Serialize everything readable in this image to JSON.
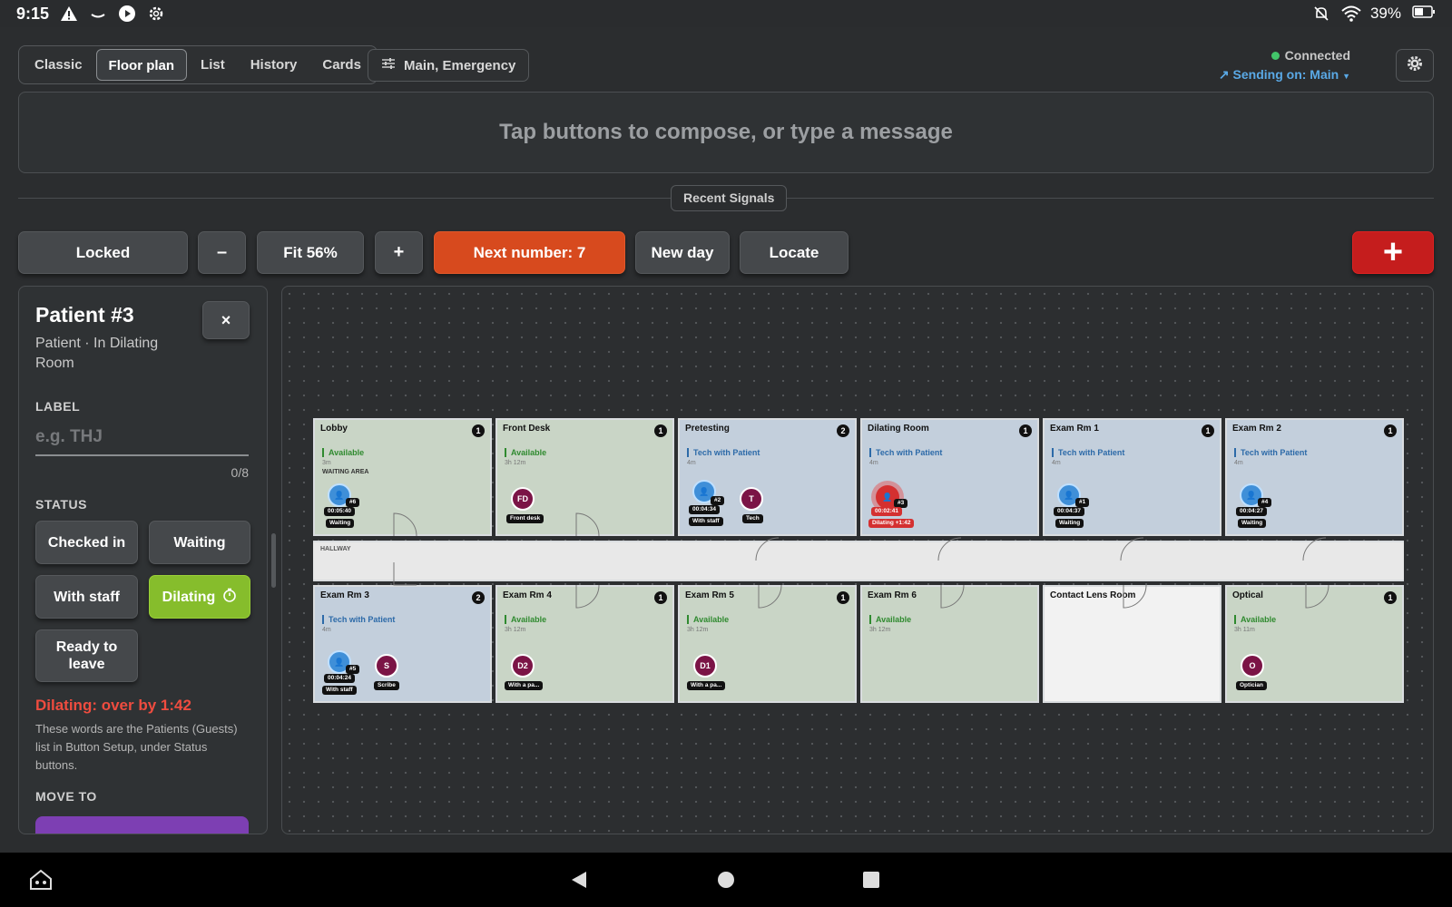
{
  "statusbar": {
    "time": "9:15",
    "battery": "39%"
  },
  "tabs": [
    "Classic",
    "Floor plan",
    "List",
    "History",
    "Cards"
  ],
  "active_tab": "Floor plan",
  "filter_label": "Main, Emergency",
  "connection": {
    "status": "Connected",
    "sending": "Sending on: Main"
  },
  "compose_placeholder": "Tap buttons to compose, or type a message",
  "recent_signals": "Recent Signals",
  "toolbar": {
    "locked": "Locked",
    "minus": "–",
    "fit": "Fit 56%",
    "plus": "+",
    "next_number": "Next number: 7",
    "new_day": "New day",
    "locate": "Locate",
    "add": "+"
  },
  "panel": {
    "title": "Patient #3",
    "subtitle": "Patient · In Dilating Room",
    "close": "×",
    "label_heading": "LABEL",
    "label_placeholder": "e.g. THJ",
    "label_count": "0/8",
    "status_heading": "STATUS",
    "status_buttons": [
      "Checked in",
      "Waiting",
      "With staff",
      "Dilating",
      "Ready to leave"
    ],
    "active_status": "Dilating",
    "overdue": "Dilating: over by 1:42",
    "help": "These words are the Patients (Guests) list in Button Setup, under Status buttons.",
    "move_to_heading": "MOVE TO"
  },
  "hallway_label": "HALLWAY",
  "rooms_top": [
    {
      "name": "Lobby",
      "count": "1",
      "status": "Available",
      "time": "3m",
      "area": "WAITING AREA"
    },
    {
      "name": "Front Desk",
      "count": "1",
      "status": "Available",
      "time": "3h 12m"
    },
    {
      "name": "Pretesting",
      "count": "2",
      "status": "Tech with Patient",
      "time": "4m"
    },
    {
      "name": "Dilating Room",
      "count": "1",
      "status": "Tech with Patient",
      "time": "4m"
    },
    {
      "name": "Exam Rm 1",
      "count": "1",
      "status": "Tech with Patient",
      "time": "4m"
    },
    {
      "name": "Exam Rm 2",
      "count": "1",
      "status": "Tech with Patient",
      "time": "4m"
    }
  ],
  "rooms_bottom": [
    {
      "name": "Exam Rm 3",
      "count": "2",
      "status": "Tech with Patient",
      "time": "4m"
    },
    {
      "name": "Exam Rm 4",
      "count": "1",
      "status": "Available",
      "time": "3h 12m"
    },
    {
      "name": "Exam Rm 5",
      "count": "1",
      "status": "Available",
      "time": "3h 12m"
    },
    {
      "name": "Exam Rm 6",
      "count": "",
      "status": "Available",
      "time": "3h 12m"
    },
    {
      "name": "Contact Lens Room",
      "count": "",
      "status": "",
      "time": ""
    },
    {
      "name": "Optical",
      "count": "1",
      "status": "Available",
      "time": "3h 11m"
    }
  ],
  "tokens": {
    "lobby": {
      "num": "#6",
      "timer": "00:05:40",
      "tag": "Waiting"
    },
    "frontdesk": {
      "initials": "FD",
      "tag": "Front desk"
    },
    "pretest_patient": {
      "num": "#2",
      "timer": "00:04:34",
      "tag": "With staff"
    },
    "pretest_staff": {
      "initials": "T",
      "tag": "Tech"
    },
    "dilating": {
      "num": "#3",
      "timer": "00:02:41",
      "tag": "Dilating +1:42"
    },
    "exam1": {
      "num": "#1",
      "timer": "00:04:37",
      "tag": "Waiting"
    },
    "exam2": {
      "num": "#4",
      "timer": "00:04:27",
      "tag": "Waiting"
    },
    "exam3_patient": {
      "num": "#5",
      "timer": "00:04:24",
      "tag": "With staff"
    },
    "exam3_staff": {
      "initials": "S",
      "tag": "Scribe"
    },
    "exam4": {
      "initials": "D2",
      "tag": "With a pa..."
    },
    "exam5": {
      "initials": "D1",
      "tag": "With a pa..."
    },
    "optical": {
      "initials": "O",
      "tag": "Optician"
    }
  },
  "colors": {
    "accent_orange": "#d74a1e",
    "accent_red": "#c51d1d",
    "dilating_green": "#86bd2c",
    "connected": "#42c46a",
    "link_blue": "#5aa9e6"
  }
}
